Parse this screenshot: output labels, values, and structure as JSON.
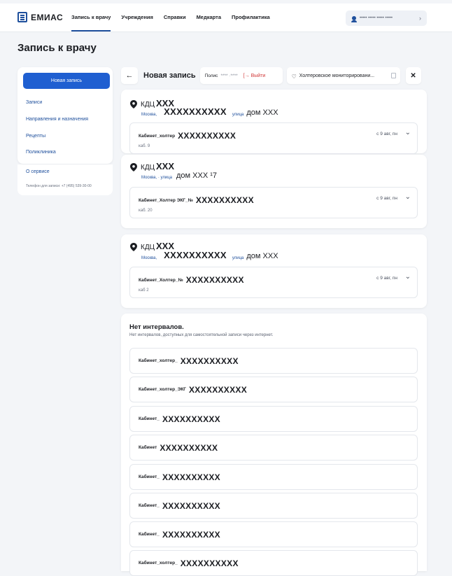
{
  "header": {
    "logo": "ЕМИАС",
    "nav": [
      "Запись к врачу",
      "Учреждения",
      "Справки",
      "Медкарта",
      "Профилактика"
    ],
    "user_name": "•••••  ••••• ••••• •••••",
    "user_chevron": "›"
  },
  "page_title": "Запись к врачу",
  "sidebar": {
    "new_button": "Новая запись",
    "links": [
      "Записи",
      "Направления и назначения",
      "Рецепты",
      "Поликлиника"
    ],
    "about": "О сервисе",
    "phone": "Телефон для записи: +7 (495) 539-30-00"
  },
  "strip": {
    "back": "←",
    "title": "Новая запись",
    "polis_label": "Полис",
    "polis_number": "**** ·****",
    "logout_icon": "[→",
    "logout": "Выйти",
    "holter": "Холтеровское мониторировани...",
    "close": "✕"
  },
  "clinics": [
    {
      "prefix": "КДЦ",
      "name": "ХХХ",
      "city": "Москва,",
      "street": "XXXXXXXXXX",
      "street_type": "улица",
      "house": "дом ХХХ",
      "room": {
        "type": "Кабинет_холтер",
        "code": "XXXXXXXXXX",
        "cab": "каб.  9",
        "date": "с 9 авг, пн"
      }
    },
    {
      "prefix": "КДЦ",
      "name": "ХХХ",
      "city": "Москва, · улица",
      "street": "",
      "street_type": "",
      "house": "дом ХХХ  ¹7",
      "room": {
        "type": "Кабинет_Холтер ЭКГ_№",
        "code": "XXXXXXXXXX",
        "cab": "каб. 20",
        "date": "с 9 авг, пн"
      }
    },
    {
      "prefix": "КДЦ",
      "name": "ХХХ",
      "city": "Москва,",
      "street": "XXXXXXXXXX",
      "street_type": "улица",
      "house": "дом ХХХ",
      "room": {
        "type": "Кабинет_Холтер_№",
        "code": "XXXXXXXXXX",
        "cab": "каб  2",
        "date": "с 9 авг, пн"
      }
    }
  ],
  "no_intervals": {
    "title": "Нет интервалов.",
    "description": "Нет интервалов, доступных для самостоятельной записи через интернет.",
    "slots": [
      {
        "label": "Кабинет_холтер_",
        "code": "XXXXXXXXXX"
      },
      {
        "label": "Кабинет_холтер_ЭКГ",
        "code": "XXXXXXXXXX"
      },
      {
        "label": "Кабинет_",
        "code": "XXXXXXXXXX"
      },
      {
        "label": "Кабинет",
        "code": "XXXXXXXXXX"
      },
      {
        "label": "Кабинет_",
        "code": "XXXXXXXXXX"
      },
      {
        "label": "Кабинет_",
        "code": "XXXXXXXXXX"
      },
      {
        "label": "Кабинет_",
        "code": "XXXXXXXXXX"
      },
      {
        "label": "Кабинет_холтер_",
        "code": "XXXXXXXXXX"
      }
    ]
  },
  "icons": {
    "back": "arrow-left-icon",
    "heart": "heart-icon",
    "pin": "map-pin-icon",
    "chevron": "chevron-down-icon"
  },
  "colors": {
    "primary": "#1f5fd1",
    "link": "#1e4f9c",
    "danger": "#d23a3a"
  }
}
